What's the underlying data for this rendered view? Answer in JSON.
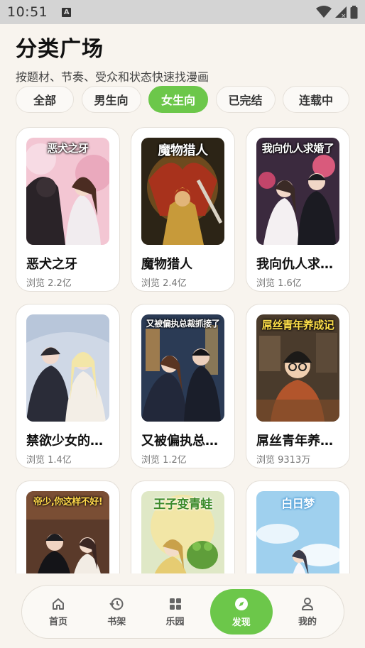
{
  "status": {
    "time": "10:51"
  },
  "page": {
    "title": "分类广场",
    "subtitle": "按题材、节奏、受众和状态快速找漫画"
  },
  "filters": [
    {
      "label": "全部",
      "active": false
    },
    {
      "label": "男生向",
      "active": false
    },
    {
      "label": "女生向",
      "active": true
    },
    {
      "label": "已完结",
      "active": false
    },
    {
      "label": "连载中",
      "active": false
    }
  ],
  "comics": [
    {
      "title": "恶犬之牙",
      "views": "浏览 2.2亿",
      "cover_text": "恶犬之牙"
    },
    {
      "title": "魔物猎人",
      "views": "浏览 2.4亿",
      "cover_text": "魔物猎人"
    },
    {
      "title": "我向仇人求婚了",
      "views": "浏览 1.6亿",
      "cover_text": "我向仇人求婚了"
    },
    {
      "title": "禁欲少女的诱惑",
      "views": "浏览 1.4亿",
      "cover_text": ""
    },
    {
      "title": "又被偏执总裁抓住了",
      "views": "浏览 1.2亿",
      "cover_text": "又被偏执总裁抓接了"
    },
    {
      "title": "屌丝青年养成记",
      "views": "浏览 9313万",
      "cover_text": "屌丝青年养成记"
    },
    {
      "title": "",
      "views": "",
      "cover_text": "帝少,你这样不好!"
    },
    {
      "title": "",
      "views": "",
      "cover_text": "王子变青蛙"
    },
    {
      "title": "",
      "views": "",
      "cover_text": "白日梦"
    }
  ],
  "nav": [
    {
      "label": "首页",
      "icon": "home-icon",
      "active": false
    },
    {
      "label": "书架",
      "icon": "history-icon",
      "active": false
    },
    {
      "label": "乐园",
      "icon": "grid-icon",
      "active": false
    },
    {
      "label": "发现",
      "icon": "compass-icon",
      "active": true
    },
    {
      "label": "我的",
      "icon": "user-icon",
      "active": false
    }
  ],
  "colors": {
    "accent": "#6cc74a",
    "background": "#f8f4ee"
  }
}
